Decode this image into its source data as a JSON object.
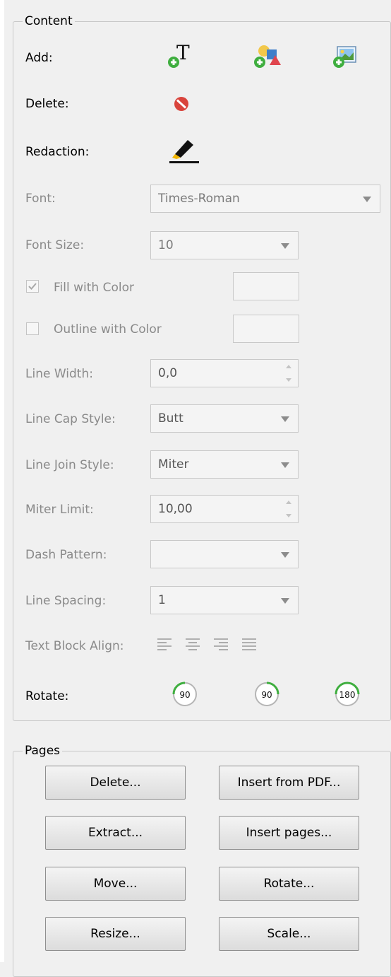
{
  "content": {
    "legend": "Content",
    "add_label": "Add:",
    "add_icons": [
      "add-text-icon",
      "add-shape-icon",
      "add-image-icon"
    ],
    "delete_label": "Delete:",
    "redaction_label": "Redaction:",
    "font_label": "Font:",
    "font_value": "Times-Roman",
    "font_size_label": "Font Size:",
    "font_size_value": "10",
    "fill_label": "Fill with Color",
    "fill_checked": true,
    "outline_label": "Outline with Color",
    "outline_checked": false,
    "line_width_label": "Line Width:",
    "line_width_value": "0,0",
    "line_cap_label": "Line Cap Style:",
    "line_cap_value": "Butt",
    "line_join_label": "Line Join Style:",
    "line_join_value": "Miter",
    "miter_limit_label": "Miter Limit:",
    "miter_limit_value": "10,00",
    "dash_pattern_label": "Dash Pattern:",
    "dash_pattern_value": "",
    "line_spacing_label": "Line Spacing:",
    "line_spacing_value": "1",
    "text_align_label": "Text Block Align:",
    "rotate_label": "Rotate:",
    "rotate_values": [
      "90",
      "90",
      "180"
    ]
  },
  "pages": {
    "legend": "Pages",
    "buttons": {
      "delete": "Delete...",
      "insert_from_pdf": "Insert from PDF...",
      "extract": "Extract...",
      "insert_pages": "Insert pages...",
      "move": "Move...",
      "rotate": "Rotate...",
      "resize": "Resize...",
      "scale": "Scale..."
    }
  },
  "colors": {
    "panel_bg": "#f0f0f0",
    "disabled_text": "#8a8a8a",
    "green_plus": "#3fae3f",
    "delete_red": "#d9443c"
  }
}
